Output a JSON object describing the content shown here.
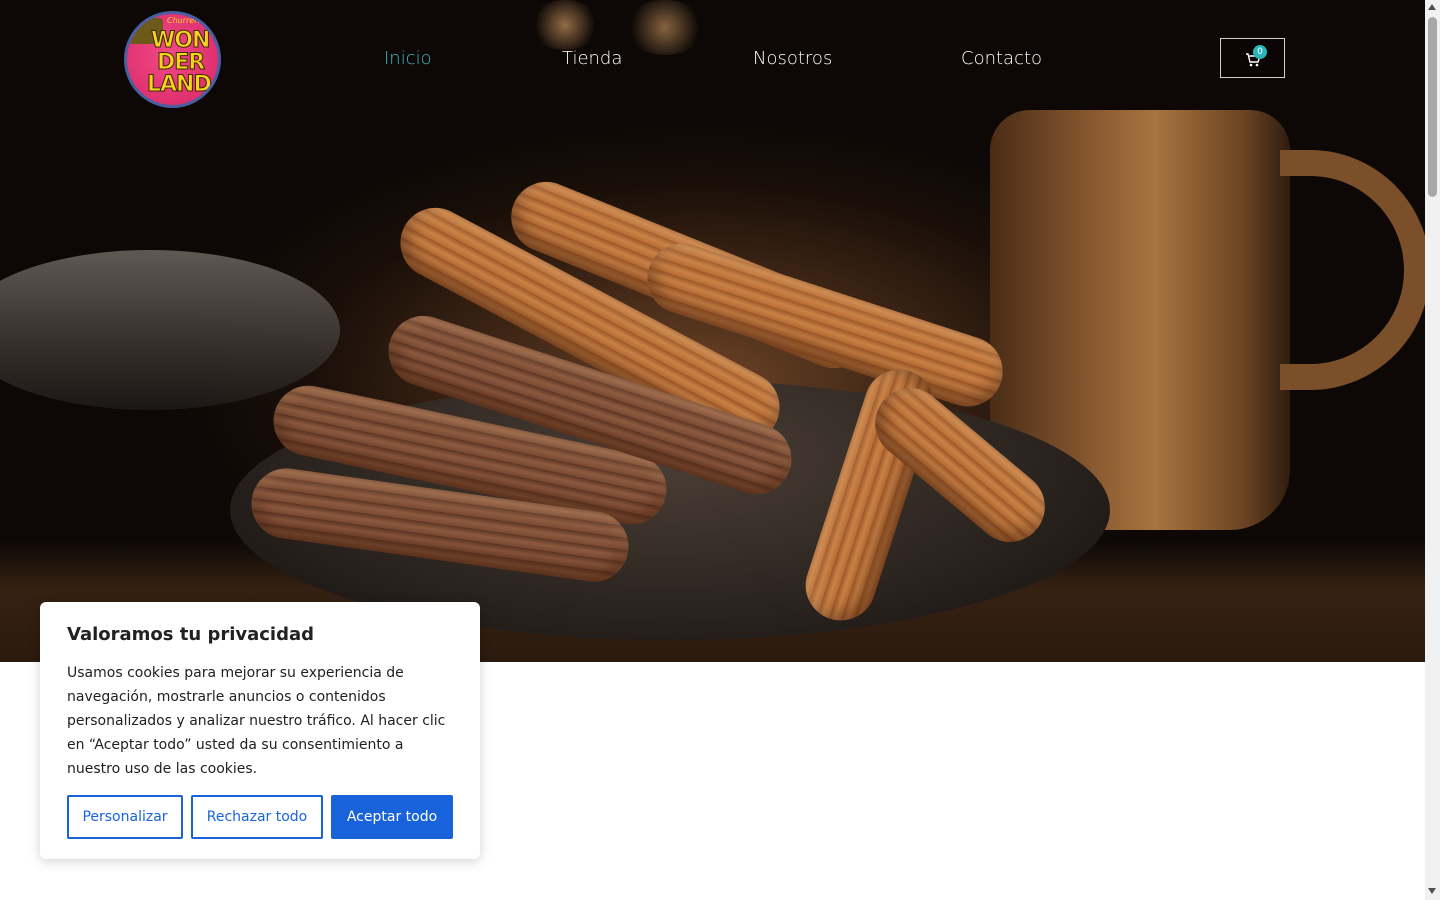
{
  "header": {
    "logo": {
      "small_text": "Churrería",
      "word_lines": [
        "WON",
        "DER",
        "LAND"
      ]
    },
    "nav": [
      {
        "label": "Inicio",
        "active": true
      },
      {
        "label": "Tienda",
        "active": false
      },
      {
        "label": "Nosotros",
        "active": false
      },
      {
        "label": "Contacto",
        "active": false
      }
    ],
    "cart": {
      "count": "0",
      "icon": "cart-icon"
    }
  },
  "colors": {
    "nav_active": "#41b3c3",
    "cart_badge": "#2ab3b9",
    "primary_button": "#1863dc"
  },
  "cookie_banner": {
    "title": "Valoramos tu privacidad",
    "body": "Usamos cookies para mejorar su experiencia de navegación, mostrarle anuncios o contenidos personalizados y analizar nuestro tráfico. Al hacer clic en “Aceptar todo” usted da su consentimiento a nuestro uso de las cookies.",
    "buttons": {
      "customize": "Personalizar",
      "reject": "Rechazar todo",
      "accept": "Aceptar todo"
    }
  }
}
